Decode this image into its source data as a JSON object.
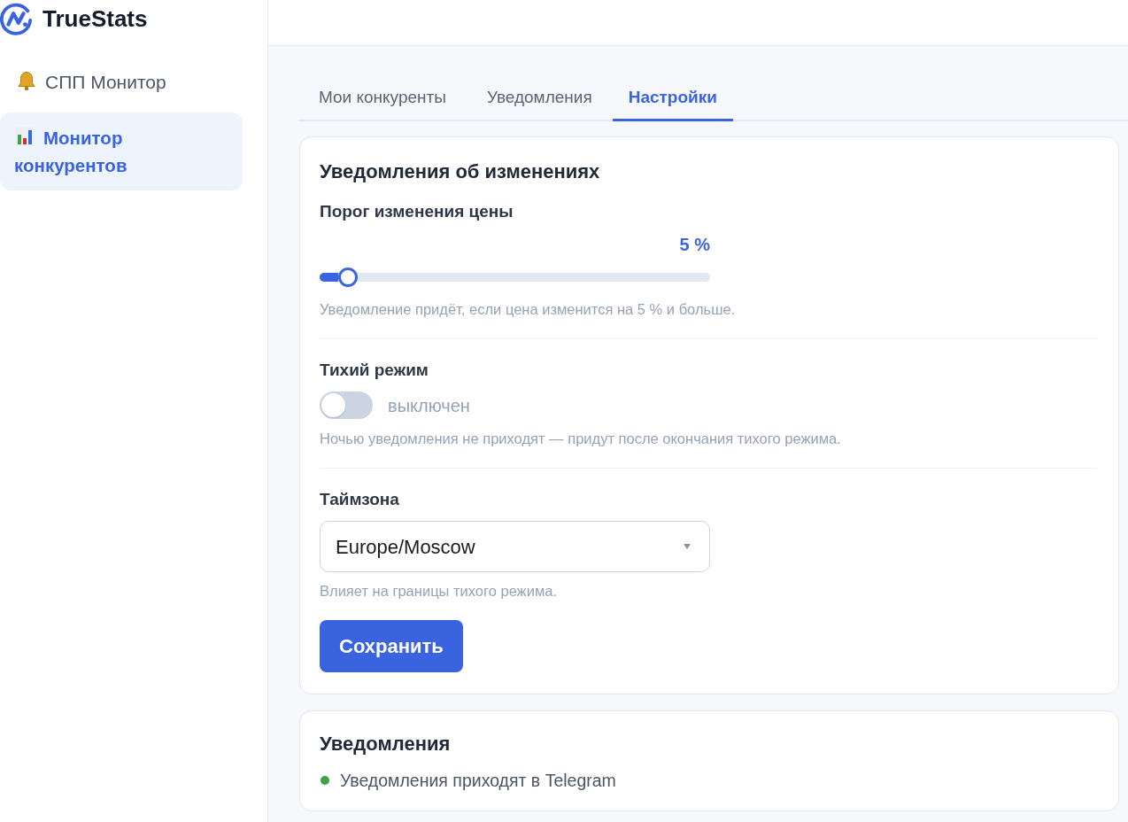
{
  "brand": {
    "name": "TrueStats"
  },
  "sidebar": {
    "items": [
      {
        "label": "СПП Монитор",
        "selected": false
      },
      {
        "label": "Монитор конкурентов",
        "selected": true
      }
    ]
  },
  "tabs": [
    {
      "label": "Мои конкуренты",
      "selected": false
    },
    {
      "label": "Уведомления",
      "selected": false
    },
    {
      "label": "Настройки",
      "selected": true
    }
  ],
  "settings_card": {
    "title": "Уведомления об изменениях",
    "threshold": {
      "label": "Порог изменения цены",
      "reading": "5 %",
      "level": 0.05,
      "hint": "Уведомление придёт, если цена изменится на 5 % и больше."
    },
    "quiet_mode": {
      "label": "Тихий режим",
      "on": false,
      "state_label": "выключен",
      "hint": "Ночью уведомления не приходят — придут после окончания тихого режима."
    },
    "timezone": {
      "label": "Таймзона",
      "value": "Europe/Moscow",
      "hint": "Влияет на границы тихого режима."
    },
    "save_button": "Сохранить"
  },
  "status_card": {
    "title": "Уведомления",
    "status": {
      "text": "Уведомления приходят в Telegram",
      "color": "#43a047"
    }
  }
}
